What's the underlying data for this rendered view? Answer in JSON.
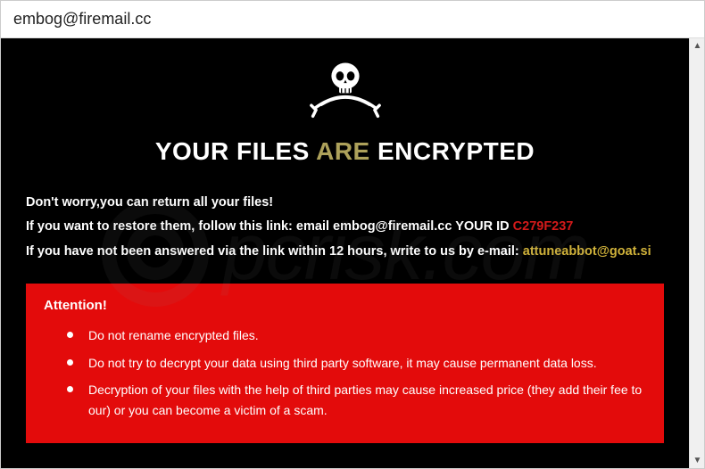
{
  "window": {
    "title": "embog@firemail.cc"
  },
  "ransom": {
    "heading_part1": "YOUR FILES ",
    "heading_accent": "ARE",
    "heading_part2": " ENCRYPTED",
    "line1": "Don't worry,you can return all your files!",
    "line2_pre": "If you want to restore them, follow this link: ",
    "line2_email_label": "email ",
    "line2_email": "embog@firemail.cc",
    "line2_yourid_label": "  YOUR ID ",
    "line2_id": "C279F237",
    "line3_pre": "If you have not been answered via the link within 12 hours, write to us by e-mail: ",
    "line3_email": "attuneabbot@goat.si"
  },
  "attention": {
    "title": "Attention!",
    "items": [
      "Do not rename encrypted files.",
      "Do not try to decrypt your data using third party software, it may cause permanent data loss.",
      "Decryption of your files with the help of third parties may cause increased price (they add their fee to our) or you can become a victim of a scam."
    ]
  },
  "watermark": {
    "text": "pcrisk.com"
  },
  "icons": {
    "skull": "skull-and-swords-icon",
    "scroll_up": "▲",
    "scroll_down": "▼"
  }
}
